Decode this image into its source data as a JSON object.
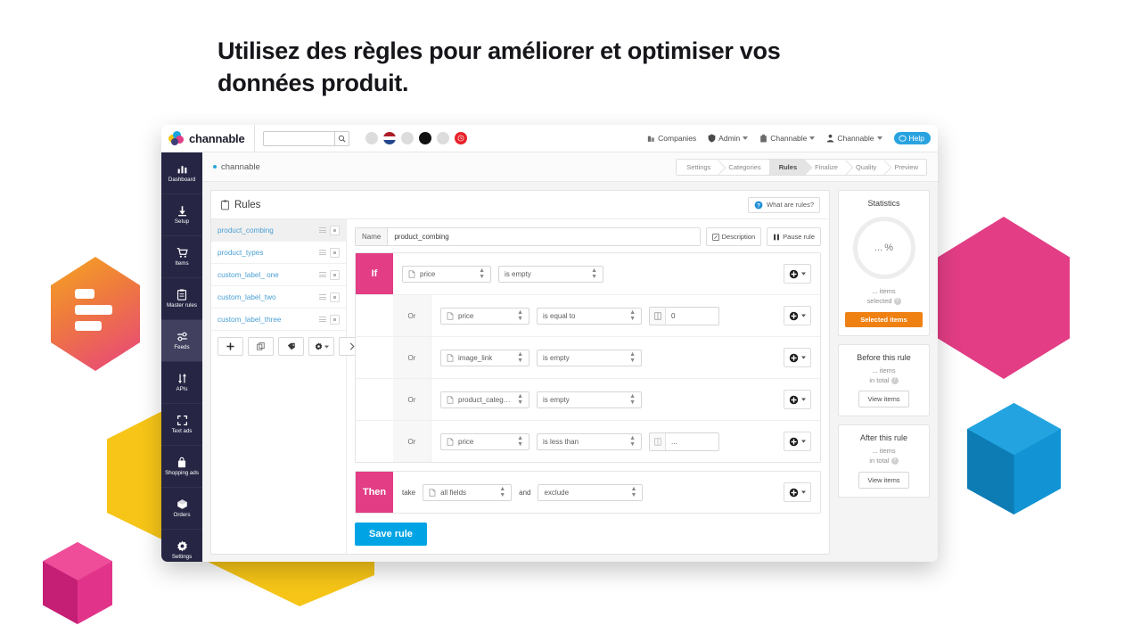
{
  "headline": "Utilisez des règles pour améliorer et optimiser vos données produit.",
  "colors": {
    "brand_pink": "#e23d85",
    "brand_blue": "#00a4e4",
    "brand_yellow": "#f6c517",
    "brand_orange": "#ef8012",
    "sidebar_dark": "#262544"
  },
  "topbar": {
    "logo_text": "channable",
    "search_placeholder": "",
    "search_value": "",
    "search_icon": "search-icon",
    "nav": [
      {
        "label": "Companies",
        "icon": "companies-icon",
        "caret": false
      },
      {
        "label": "Admin",
        "icon": "shield-icon",
        "caret": true
      },
      {
        "label": "Channable",
        "icon": "briefcase-icon",
        "caret": true
      },
      {
        "label": "Channable",
        "icon": "user-icon",
        "caret": true
      }
    ],
    "help_label": "Help",
    "help_icon": "chat-bubble-icon"
  },
  "sidebar": {
    "items": [
      {
        "label": "Dashboard",
        "icon": "bar-chart-icon",
        "active": false
      },
      {
        "label": "Setup",
        "icon": "download-icon",
        "active": false
      },
      {
        "label": "Items",
        "icon": "cart-icon",
        "active": false
      },
      {
        "label": "Master rules",
        "icon": "clipboard-icon",
        "active": false
      },
      {
        "label": "Feeds",
        "icon": "sliders-icon",
        "active": true
      },
      {
        "label": "APIs",
        "icon": "arrows-updown-icon",
        "active": false
      },
      {
        "label": "Text ads",
        "icon": "crop-frame-icon",
        "active": false
      },
      {
        "label": "Shopping ads",
        "icon": "bag-icon",
        "active": false
      },
      {
        "label": "Orders",
        "icon": "box-icon",
        "active": false
      },
      {
        "label": "Settings",
        "icon": "gear-icon",
        "active": false
      }
    ]
  },
  "breadcrumb": {
    "label": "channable"
  },
  "steps": [
    {
      "label": "Settings",
      "active": false
    },
    {
      "label": "Categories",
      "active": false
    },
    {
      "label": "Rules",
      "active": true
    },
    {
      "label": "Finalize",
      "active": false
    },
    {
      "label": "Quality",
      "active": false
    },
    {
      "label": "Preview",
      "active": false
    }
  ],
  "rules_panel": {
    "title": "Rules",
    "title_icon": "clipboard-icon",
    "help_label": "What are rules?",
    "help_icon": "question-circle-icon",
    "list": [
      {
        "name": "product_combing",
        "active": true
      },
      {
        "name": "product_types",
        "active": false
      },
      {
        "name": "custom_label_ one",
        "active": false
      },
      {
        "name": "custom_label_two",
        "active": false
      },
      {
        "name": "custom_label_three",
        "active": false
      }
    ],
    "list_footer_buttons": [
      {
        "icon": "plus-icon",
        "label": "+"
      },
      {
        "icon": "copy-icon",
        "label": ""
      },
      {
        "icon": "tag-icon",
        "label": ""
      },
      {
        "icon": "gear-icon",
        "label": "",
        "caret": true
      },
      {
        "icon": "chevron-right-icon",
        "label": ""
      }
    ]
  },
  "editor": {
    "name_label": "Name",
    "name_value": "product_combing",
    "description_label": "Description",
    "description_icon": "edit-square-icon",
    "pause_label": "Pause rule",
    "pause_icon": "pause-icon",
    "if_tag": "If",
    "or_label": "Or",
    "then_tag": "Then",
    "take_label": "take",
    "and_label": "and",
    "add_icon": "plus-circle-icon",
    "caret_icon": "caret-down-icon",
    "field_icon": "file-icon",
    "value_icon": "columns-icon",
    "conditions": [
      {
        "connector": "If",
        "field": "price",
        "operator": "is empty",
        "value": null
      },
      {
        "connector": "Or",
        "field": "price",
        "operator": "is equal to",
        "value": "0"
      },
      {
        "connector": "Or",
        "field": "image_link",
        "operator": "is empty",
        "value": null
      },
      {
        "connector": "Or",
        "field": "product_category",
        "operator": "is empty",
        "value": null
      },
      {
        "connector": "Or",
        "field": "price",
        "operator": "is less than",
        "value": "..."
      }
    ],
    "action": {
      "field": "all fields",
      "operation": "exclude"
    },
    "save_label": "Save rule"
  },
  "stats": {
    "title": "Statistics",
    "percent_value": "...",
    "percent_symbol": "%",
    "items_count": "...",
    "items_word": "items",
    "selected_word": "selected",
    "selected_button": "Selected items",
    "cards": [
      {
        "title": "Before this rule",
        "count": "...",
        "items_word": "items",
        "total_word": "in total",
        "button": "View items"
      },
      {
        "title": "After this rule",
        "count": "...",
        "items_word": "items",
        "total_word": "in total",
        "button": "View items"
      }
    ]
  }
}
